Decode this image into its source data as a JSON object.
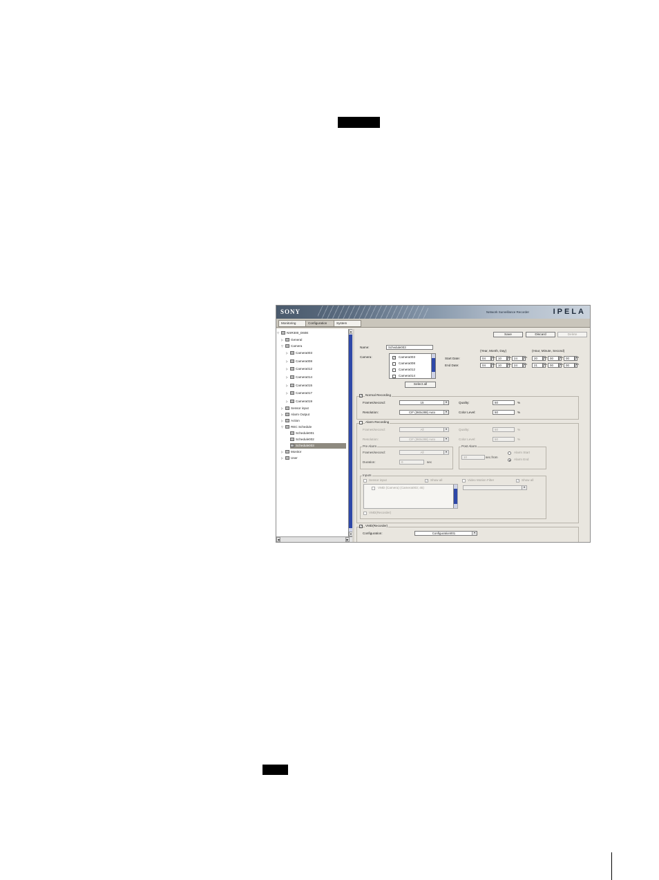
{
  "app": {
    "brand_left": "SONY",
    "product": "Network Surveillance Recorder",
    "brand_right": "IPELA"
  },
  "tabs": [
    "Monitoring",
    "Configuration",
    "System"
  ],
  "tree": {
    "root": "NSR300_D60E",
    "general": "General",
    "camera": "Camera",
    "cameras": [
      "Camera003",
      "Camera008",
      "Camera012",
      "Camera014",
      "Camera015",
      "Camera017",
      "Camera019"
    ],
    "sensor_input": "Sensor input",
    "alarm_output": "Alarm Output",
    "action": "Action",
    "rec_schedule": "REC Schedule",
    "schedules": [
      "Schedule001",
      "Schedule002",
      "Schedule003"
    ],
    "monitor": "Monitor",
    "user": "User"
  },
  "toolbar": {
    "save": "Save",
    "discard": "Discard",
    "delete": "Delete"
  },
  "form": {
    "name_label": "Name:",
    "name_value": "Schedule003",
    "camera_label": "Camera:",
    "camera_list": [
      {
        "label": "Camera003",
        "checked": true
      },
      {
        "label": "Camera008",
        "checked": false
      },
      {
        "label": "Camera012",
        "checked": false
      },
      {
        "label": "Camera014",
        "checked": false
      }
    ],
    "select_all": "Select all",
    "ymd_header": "(Year, Month, Day)",
    "hms_header": "(Hour, Minute, Second)",
    "start_label": "Start Date:",
    "end_label": "End Date:",
    "start_ymd": [
      "04",
      "10",
      "24"
    ],
    "start_hms": [
      "20",
      "00",
      "00"
    ],
    "end_ymd": [
      "04",
      "10",
      "24"
    ],
    "end_hms": [
      "21",
      "00",
      "00"
    ]
  },
  "normal": {
    "title": "Normal Recording",
    "fps_label": "Frames/second:",
    "fps_value": "15",
    "res_label": "Resolution:",
    "res_value": "CIF (360x288) Auto",
    "quality_label": "Quality:",
    "quality_value": "50",
    "color_label": "Color Level:",
    "color_value": "50",
    "pct": "%"
  },
  "alarm": {
    "title": "Alarm Recording",
    "fps_label": "Frames/second:",
    "fps_value": "All",
    "res_label": "Resolution:",
    "res_value": "CIF (360x288) Auto",
    "quality_label": "Quality:",
    "quality_value": "50",
    "color_label": "Color Level:",
    "color_value": "50",
    "pct": "%",
    "pre_title": "Pre Alarm",
    "pre_fps_label": "Frames/second:",
    "pre_fps_value": "All",
    "duration_label": "Duration:",
    "duration_value": "0",
    "sec": "sec",
    "post_title": "Post Alarm",
    "post_value": "10",
    "post_unit": "sec.from",
    "alarm_start": "Alarm Start",
    "alarm_end": "Alarm End",
    "inputs_title": "Inputs",
    "sensor_input": "Sensor input",
    "show_all_1": "Show all",
    "vmf": "Video Motion Filter",
    "show_all_2": "Show all",
    "vmd_item": "VMD (Camera) (Camera003; 45)",
    "vmd_recorder_input": "VMD(Recorder)"
  },
  "vmd": {
    "title": "VMD(Recorder)",
    "config_label": "Configuration:",
    "config_value": "Configuration001"
  }
}
